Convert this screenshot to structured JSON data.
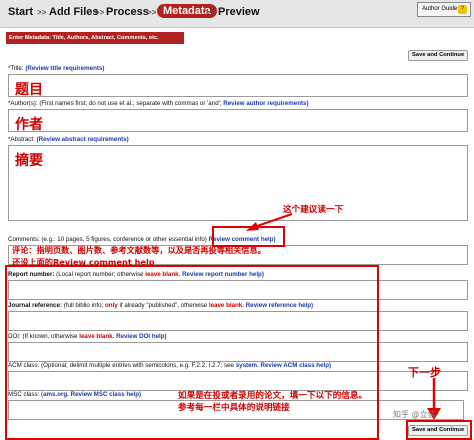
{
  "steps": [
    {
      "label": "Start"
    },
    {
      "label": "Add Files"
    },
    {
      "label": "Process"
    },
    {
      "label": "Metadata"
    },
    {
      "label": "Preview"
    }
  ],
  "step_separator": ">>",
  "author_guide": "Author Guide",
  "banner": "Enter Metadata: Title, Authors, Abstract, Comments, etc.",
  "save_label": "Save and Continue",
  "fields": {
    "title": {
      "label": "*Title:",
      "link": "(Review title requirements)",
      "value": "题目"
    },
    "authors": {
      "label": "*Author(s):",
      "hint": "(First names first; do not use et al.; separate with commas or 'and';",
      "link": "Review author requirements)",
      "value": "作者"
    },
    "abstract": {
      "label": "*Abstract:",
      "link": "(Review abstract requirements)",
      "value": "摘要"
    },
    "comments": {
      "label": "Comments:",
      "hint": "(e.g.: 10 pages, 5 figures, conference or other essential info)",
      "link": "Review comment help)"
    },
    "report": {
      "label": "Report number:",
      "hint": "(Local report number; otherwise",
      "red": "leave blank.",
      "link": "Review report number help)"
    },
    "journal": {
      "label": "Journal reference:",
      "hint": "(full biblio info;",
      "red1": "only",
      "hint2": "if already \"published\", otherwise",
      "red2": "leave blank.",
      "link": "Review reference help)"
    },
    "doi": {
      "label": "DOI:",
      "hint": "(If known, otherwise",
      "red": "leave blank.",
      "link": "Review DOI help)"
    },
    "acm": {
      "label": "ACM class:",
      "hint": "(Optional; delimit multiple entries with semicolons, e.g. F.2.2; I.2.7; see",
      "link": "system.",
      "link2": "Review ACM class help)"
    },
    "msc": {
      "label": "MSC class:",
      "hint": "(",
      "link": "ams.org.",
      "link2": "Review MSC class help)"
    }
  },
  "annotations": {
    "suggest": "这个建议读一下",
    "comment_line1": "评论：指明页数、图片数、参考文献数等，以及是否再投等相关信息。",
    "comment_line2": "还设上面的Review comment help",
    "next": "下一步",
    "optional_line1": "如果是在投或者录用的论文，填一下以下的信息。",
    "optional_line2": "参考每一栏中具体的说明链接"
  },
  "watermark": "知乎 @立信"
}
